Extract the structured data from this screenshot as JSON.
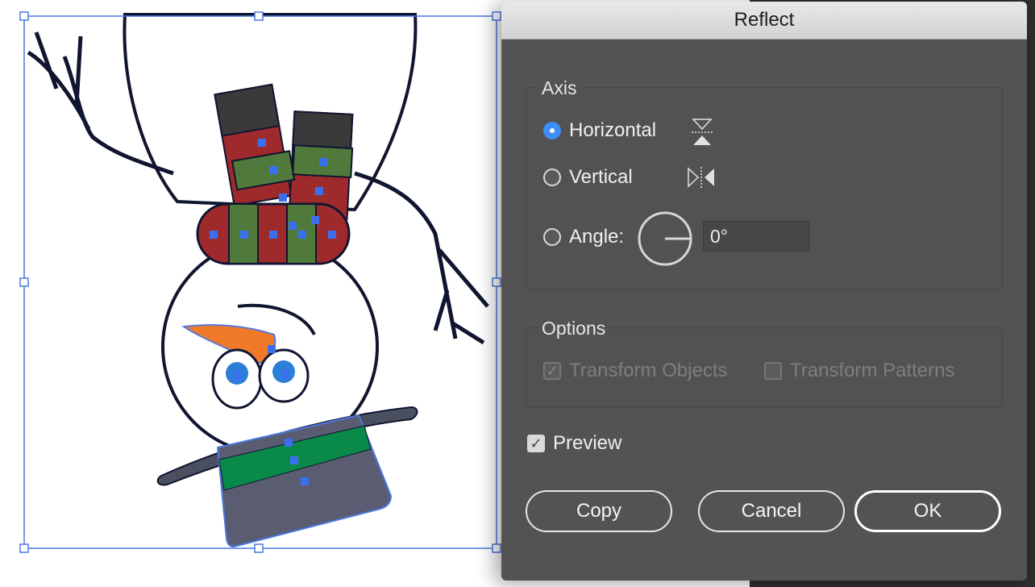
{
  "dialog": {
    "title": "Reflect",
    "axis": {
      "label": "Axis",
      "options": [
        {
          "label": "Horizontal",
          "checked": true
        },
        {
          "label": "Vertical",
          "checked": false
        },
        {
          "label": "Angle:",
          "checked": false
        }
      ],
      "angle_value": "0°"
    },
    "options": {
      "label": "Options",
      "transform_objects": {
        "label": "Transform Objects",
        "checked": true,
        "enabled": false
      },
      "transform_patterns": {
        "label": "Transform Patterns",
        "checked": false,
        "enabled": false
      }
    },
    "preview": {
      "label": "Preview",
      "checked": true
    },
    "buttons": {
      "copy": "Copy",
      "cancel": "Cancel",
      "ok": "OK"
    }
  },
  "colors": {
    "accent": "#3d8ef5",
    "dialog_bg": "#535353",
    "selection": "#4a78e0",
    "scarf_red": "#9e2a2b",
    "scarf_green": "#4f7a3b",
    "hat": "#5a5d72",
    "hat_band": "#0a8a4a",
    "carrot": "#f07a2a"
  }
}
